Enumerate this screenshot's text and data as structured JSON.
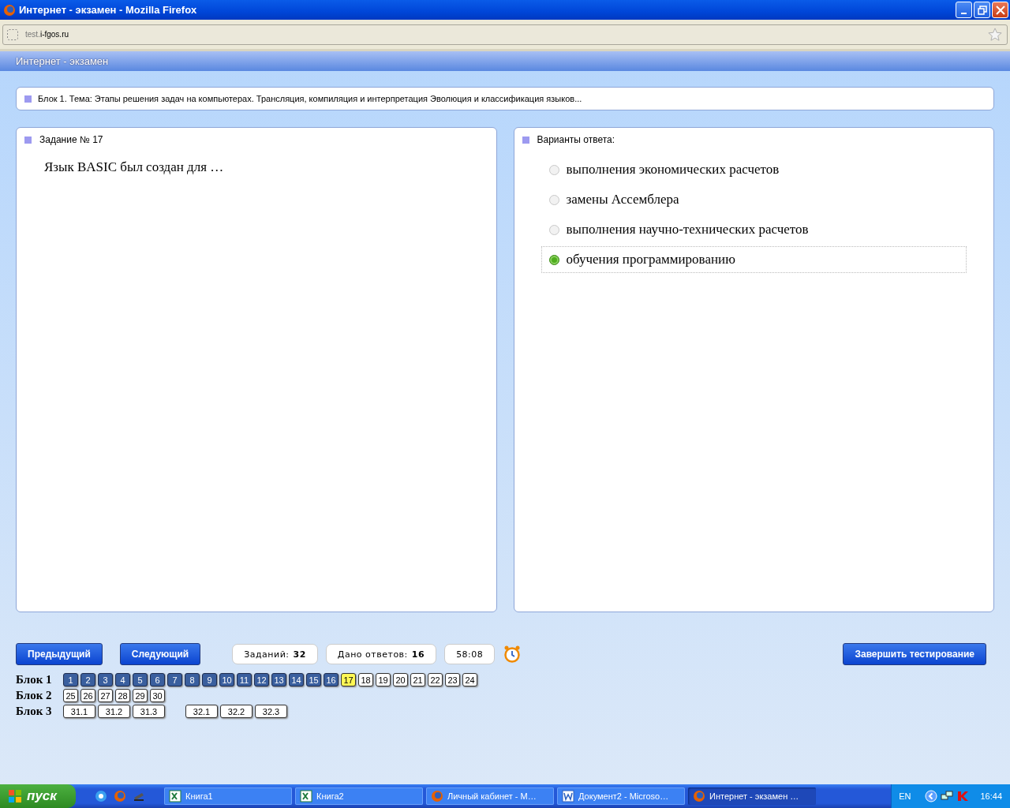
{
  "window": {
    "title": "Интернет - экзамен - Mozilla Firefox"
  },
  "address_bar": {
    "prefix": "test.",
    "domain": "i-fgos.ru"
  },
  "page_header": {
    "title": "Интернет - экзамен"
  },
  "block_banner": "Блок 1. Тема: Этапы решения задач на компьютерах. Трансляция, компиляция и интерпретация Эволюция и классификация языков...",
  "task": {
    "heading": "Задание № 17",
    "question": "Язык BASIC был создан для …"
  },
  "answers": {
    "heading": "Варианты ответа:",
    "options": [
      {
        "text": "выполнения экономических расчетов",
        "selected": false
      },
      {
        "text": "замены Ассемблера",
        "selected": false
      },
      {
        "text": "выполнения научно-технических расчетов",
        "selected": false
      },
      {
        "text": "обучения программированию",
        "selected": true
      }
    ]
  },
  "nav_buttons": {
    "previous": "Предыдущий",
    "next": "Следующий",
    "finish": "Завершить тестирование"
  },
  "counters": [
    {
      "label": "Заданий:",
      "value": "32"
    },
    {
      "label": "Дано ответов:",
      "value": "16"
    },
    {
      "value": "58:08"
    }
  ],
  "blocks": [
    {
      "label": "Блок 1",
      "groups": [
        [
          {
            "n": "1",
            "answered": true,
            "selected": false
          },
          {
            "n": "2",
            "answered": true,
            "selected": false
          },
          {
            "n": "3",
            "answered": true,
            "selected": false
          },
          {
            "n": "4",
            "answered": true,
            "selected": false
          },
          {
            "n": "5",
            "answered": true,
            "selected": false
          },
          {
            "n": "6",
            "answered": true,
            "selected": false
          },
          {
            "n": "7",
            "answered": true,
            "selected": false
          },
          {
            "n": "8",
            "answered": true,
            "selected": false
          },
          {
            "n": "9",
            "answered": true,
            "selected": false
          },
          {
            "n": "10",
            "answered": true,
            "selected": false
          },
          {
            "n": "11",
            "answered": true,
            "selected": false
          },
          {
            "n": "12",
            "answered": true,
            "selected": false
          },
          {
            "n": "13",
            "answered": true,
            "selected": false
          },
          {
            "n": "14",
            "answered": true,
            "selected": false
          },
          {
            "n": "15",
            "answered": true,
            "selected": false
          },
          {
            "n": "16",
            "answered": true,
            "selected": false
          },
          {
            "n": "17",
            "answered": false,
            "selected": true
          },
          {
            "n": "18",
            "answered": false,
            "selected": false
          },
          {
            "n": "19",
            "answered": false,
            "selected": false
          },
          {
            "n": "20",
            "answered": false,
            "selected": false
          },
          {
            "n": "21",
            "answered": false,
            "selected": false
          },
          {
            "n": "22",
            "answered": false,
            "selected": false
          },
          {
            "n": "23",
            "answered": false,
            "selected": false
          },
          {
            "n": "24",
            "answered": false,
            "selected": false
          }
        ]
      ]
    },
    {
      "label": "Блок 2",
      "groups": [
        [
          {
            "n": "25",
            "answered": false,
            "selected": false
          },
          {
            "n": "26",
            "answered": false,
            "selected": false
          },
          {
            "n": "27",
            "answered": false,
            "selected": false
          },
          {
            "n": "28",
            "answered": false,
            "selected": false
          },
          {
            "n": "29",
            "answered": false,
            "selected": false
          },
          {
            "n": "30",
            "answered": false,
            "selected": false
          }
        ]
      ]
    },
    {
      "label": "Блок 3",
      "groups": [
        [
          {
            "n": "31.1",
            "answered": false,
            "selected": false
          },
          {
            "n": "31.2",
            "answered": false,
            "selected": false
          },
          {
            "n": "31.3",
            "answered": false,
            "selected": false
          }
        ],
        [
          {
            "n": "32.1",
            "answered": false,
            "selected": false
          },
          {
            "n": "32.2",
            "answered": false,
            "selected": false
          },
          {
            "n": "32.3",
            "answered": false,
            "selected": false
          }
        ]
      ]
    }
  ],
  "taskbar": {
    "start": "пуск",
    "tasks": [
      {
        "label": "Книга1",
        "kind": "excel",
        "selected": false
      },
      {
        "label": "Книга2",
        "kind": "excel",
        "selected": false
      },
      {
        "label": "Личный кабинет - M…",
        "kind": "firefox",
        "selected": false
      },
      {
        "label": "Документ2 - Microso…",
        "kind": "word",
        "selected": false
      },
      {
        "label": "Интернет - экзамен …",
        "kind": "firefox",
        "selected": true
      }
    ],
    "language": "EN",
    "time": "16:44"
  }
}
